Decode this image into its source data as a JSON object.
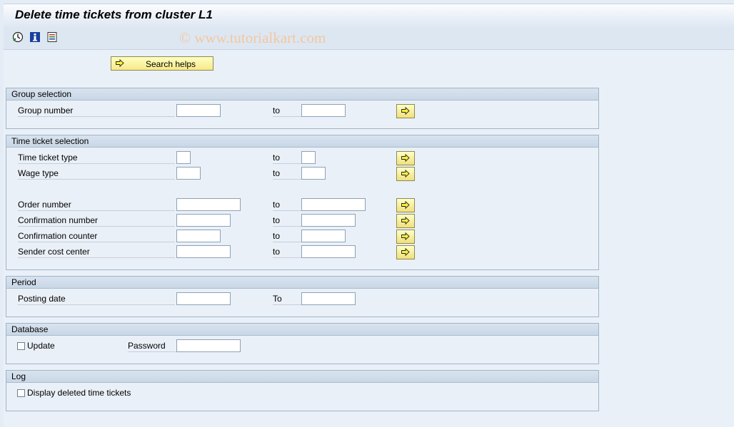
{
  "title": "Delete time tickets from cluster L1",
  "toolbar": {
    "icons": [
      "execute-clock-icon",
      "info-icon",
      "variant-list-icon"
    ]
  },
  "watermark": "© www.tutorialkart.com",
  "search_helps_label": "Search helps",
  "groups": {
    "group_selection": {
      "header": "Group selection",
      "group_number": {
        "label": "Group number",
        "to": "to",
        "from_value": "",
        "to_value": ""
      }
    },
    "time_ticket_selection": {
      "header": "Time ticket selection",
      "time_ticket_type": {
        "label": "Time ticket type",
        "to": "to",
        "from_value": "",
        "to_value": ""
      },
      "wage_type": {
        "label": "Wage type",
        "to": "to",
        "from_value": "",
        "to_value": ""
      },
      "order_number": {
        "label": "Order number",
        "to": "to",
        "from_value": "",
        "to_value": ""
      },
      "confirmation_number": {
        "label": "Confirmation number",
        "to": "to",
        "from_value": "",
        "to_value": ""
      },
      "confirmation_counter": {
        "label": "Confirmation counter",
        "to": "to",
        "from_value": "",
        "to_value": ""
      },
      "sender_cost_center": {
        "label": "Sender cost center",
        "to": "to",
        "from_value": "",
        "to_value": ""
      }
    },
    "period": {
      "header": "Period",
      "posting_date": {
        "label": "Posting date",
        "to": "To",
        "from_value": "",
        "to_value": ""
      }
    },
    "database": {
      "header": "Database",
      "update_label": "Update",
      "update_checked": false,
      "password_label": "Password",
      "password_value": ""
    },
    "log": {
      "header": "Log",
      "display_deleted_label": "Display deleted time tickets",
      "display_deleted_checked": false
    }
  }
}
